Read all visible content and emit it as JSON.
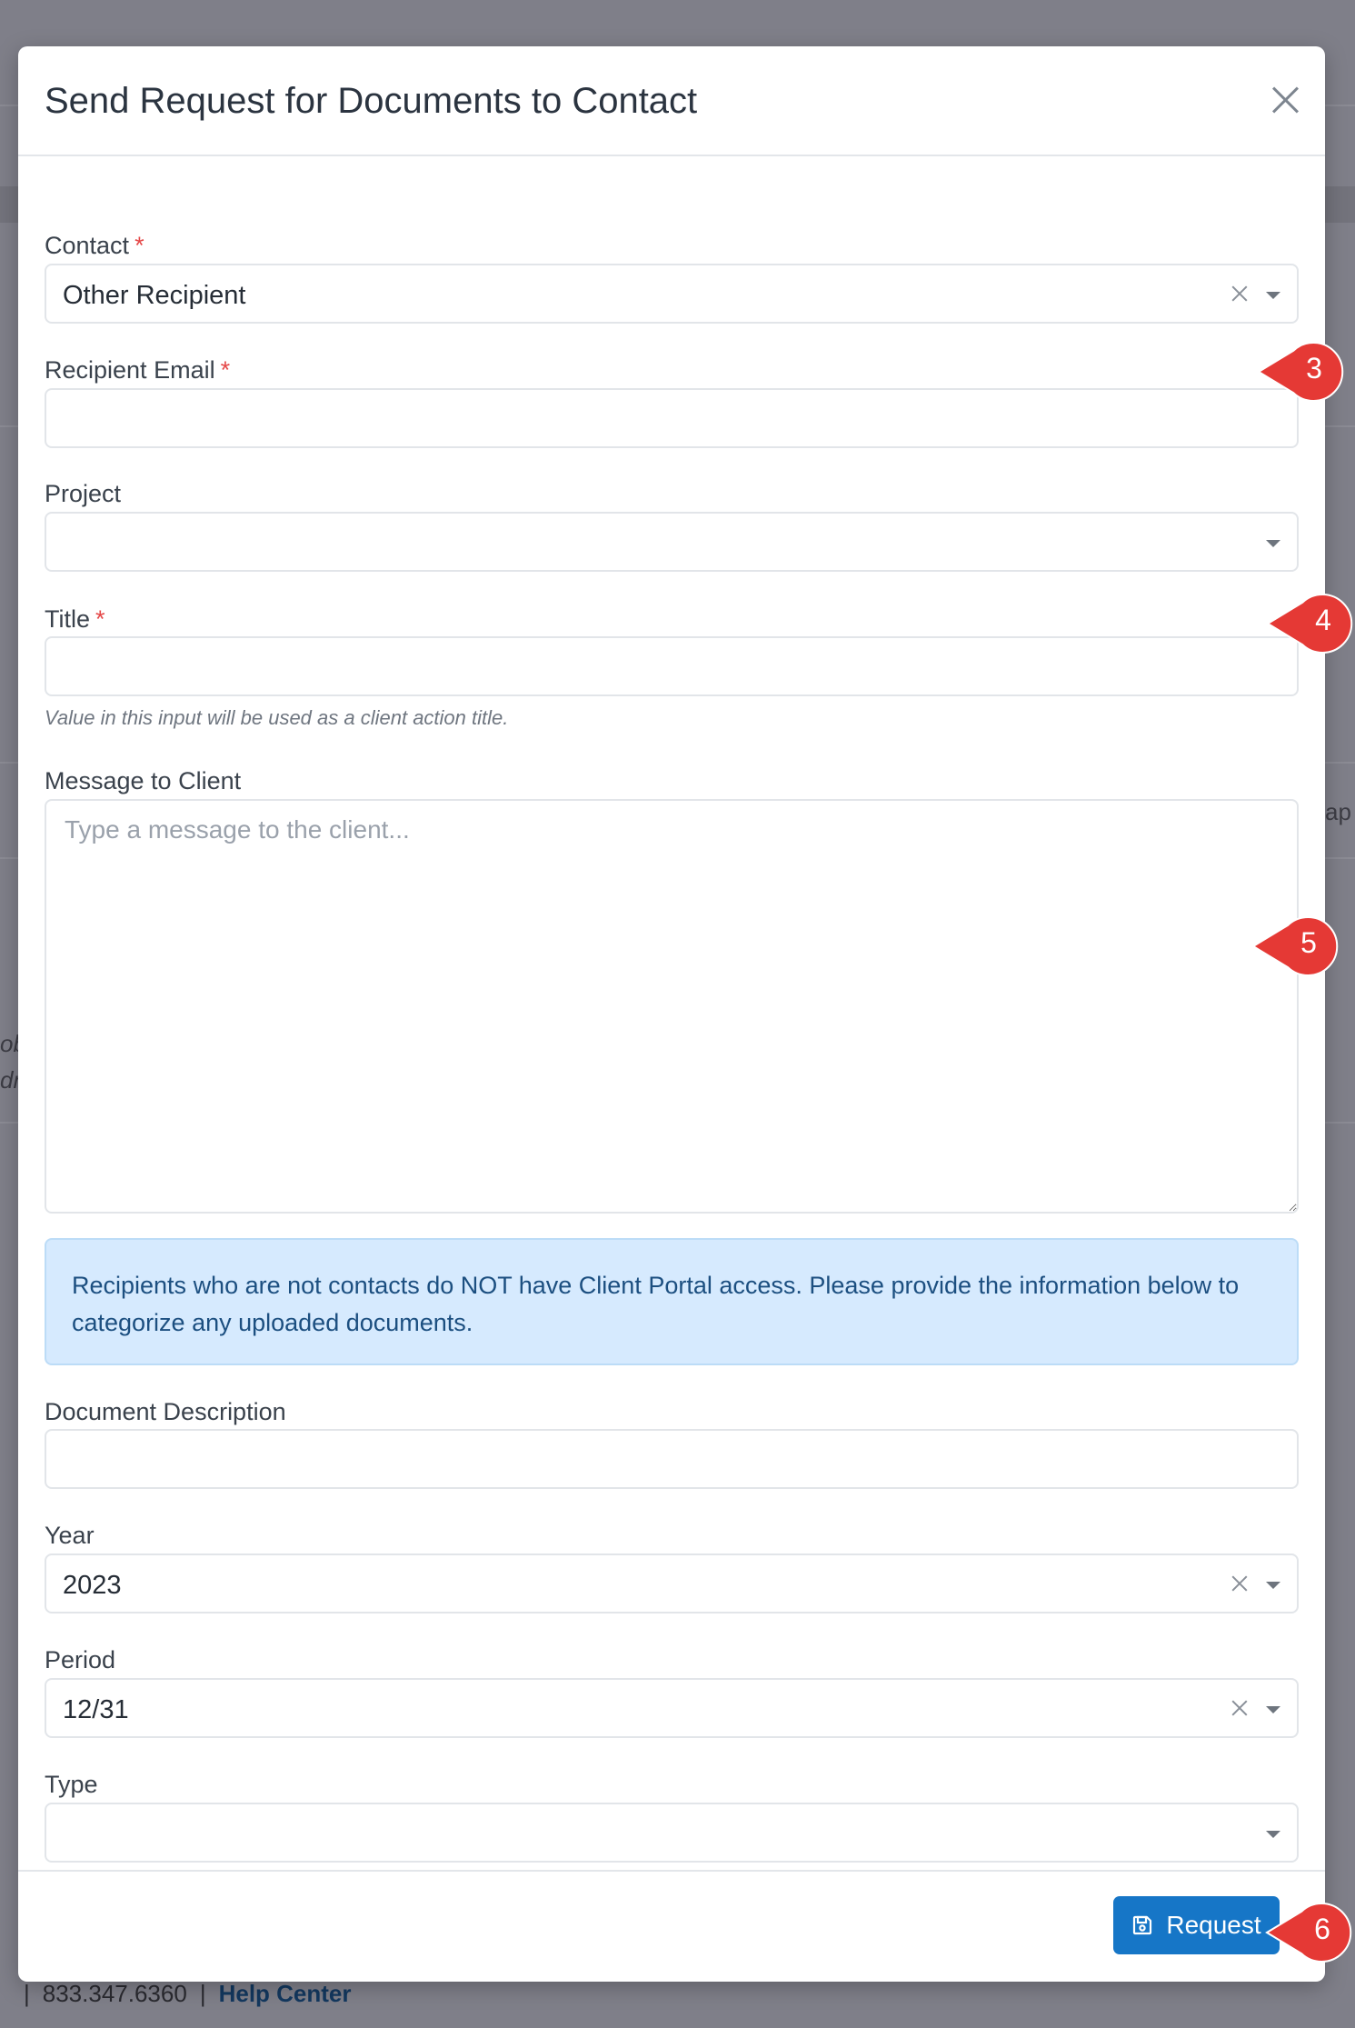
{
  "modal": {
    "title": "Send Request for Documents to Contact",
    "fields": {
      "contact": {
        "label": "Contact",
        "value": "Other Recipient",
        "required": "*"
      },
      "recipient_email": {
        "label": "Recipient Email",
        "value": "",
        "required": "*"
      },
      "project": {
        "label": "Project",
        "value": ""
      },
      "title": {
        "label": "Title",
        "value": "",
        "required": "*",
        "help": "Value in this input will be used as a client action title."
      },
      "message": {
        "label": "Message to Client",
        "placeholder": "Type a message to the client..."
      },
      "info": "Recipients who are not contacts do NOT have Client Portal access. Please provide the information below to categorize any uploaded documents.",
      "document_description": {
        "label": "Document Description",
        "value": ""
      },
      "year": {
        "label": "Year",
        "value": "2023"
      },
      "period": {
        "label": "Period",
        "value": "12/31"
      },
      "type": {
        "label": "Type",
        "value": ""
      }
    },
    "request_label": "Request"
  },
  "callouts": [
    "3",
    "4",
    "5",
    "6"
  ],
  "footer": {
    "phone": "833.347.6360",
    "help_link": "Help Center"
  },
  "background_fragments": [
    "ob",
    "dr",
    "ap"
  ],
  "colors": {
    "accent": "#1676c7",
    "info_bg": "#d6eafe",
    "callout": "#e53935",
    "required": "#e54848"
  }
}
